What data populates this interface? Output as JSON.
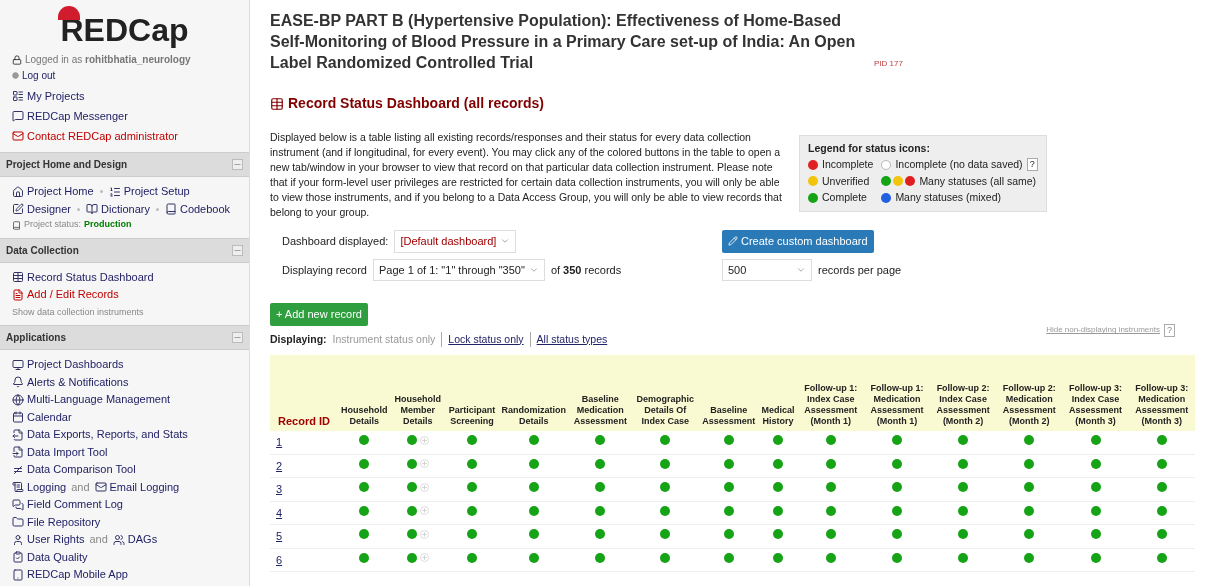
{
  "sidebar": {
    "logo": "REDCap",
    "user": "Logged in as **rohitbhatia_neurology**",
    "logout": "Log out",
    "links": [
      {
        "label": "My Projects",
        "kind": "link"
      },
      {
        "label": "REDCap Messenger",
        "kind": "link"
      },
      {
        "label": "Contact REDCap administrator",
        "kind": "alert"
      }
    ],
    "sections": [
      {
        "title": "Project Home and Design",
        "lines": [
          [
            {
              "label": "Project Home",
              "kind": "link"
            },
            {
              "label": "Project Setup",
              "kind": "link"
            }
          ],
          [
            {
              "label": "Designer",
              "kind": "link"
            },
            {
              "label": "Dictionary",
              "kind": "link"
            },
            {
              "label": "Codebook",
              "kind": "link"
            }
          ]
        ],
        "status_label": "Project status:",
        "status_value": "Production"
      },
      {
        "title": "Data Collection",
        "lines": [
          [
            {
              "label": "Record Status Dashboard",
              "kind": "link"
            }
          ],
          [
            {
              "label": "Add / Edit Records",
              "kind": "alert"
            }
          ]
        ],
        "note": "Show data collection instruments"
      },
      {
        "title": "Applications",
        "lines": [
          [
            {
              "label": "Project Dashboards",
              "kind": "link"
            }
          ],
          [
            {
              "label": "Alerts & Notifications",
              "kind": "link"
            }
          ],
          [
            {
              "label": "Multi-Language Management",
              "kind": "link"
            }
          ],
          [
            {
              "label": "Calendar",
              "kind": "link"
            }
          ],
          [
            {
              "label": "Data Exports, Reports, and Stats",
              "kind": "link"
            }
          ],
          [
            {
              "label": "Data Import Tool",
              "kind": "link"
            }
          ],
          [
            {
              "label": "Data Comparison Tool",
              "kind": "link"
            }
          ],
          [
            {
              "label": "Logging",
              "kind": "link"
            },
            {
              "label": "and",
              "kind": "joiner"
            },
            {
              "label": "Email Logging",
              "kind": "link"
            }
          ],
          [
            {
              "label": "Field Comment Log",
              "kind": "link"
            }
          ],
          [
            {
              "label": "File Repository",
              "kind": "link"
            }
          ],
          [
            {
              "label": "User Rights",
              "kind": "link"
            },
            {
              "label": "and",
              "kind": "joiner"
            },
            {
              "label": "DAGs",
              "kind": "link"
            }
          ],
          [
            {
              "label": "Data Quality",
              "kind": "link"
            }
          ],
          [
            {
              "label": "REDCap Mobile App",
              "kind": "link"
            }
          ]
        ]
      }
    ]
  },
  "project": {
    "title": "EASE-BP PART B (Hypertensive Population): Effectiveness of Home-Based Self-Monitoring of Blood Pressure in a Primary Care set-up of India: An Open Label Randomized Controlled Trial",
    "pid": "PID 177"
  },
  "heading": "Record Status Dashboard (all records)",
  "description": "Displayed below is a table listing all existing records/responses and their status for every data collection instrument (and if longitudinal, for every event). You may click any of the colored buttons in the table to open a new tab/window in your browser to view that record on that particular data collection instrument. Please note that if your form-level user privileges are restricted for certain data collection instruments, you will only be able to view those instruments, and if you belong to a Data Access Group, you will only be able to view records that belong to your group.",
  "legend": {
    "title": "Legend for status icons:",
    "items": [
      {
        "icons": [
          {
            "color": "#e02020"
          }
        ],
        "label": "Incomplete"
      },
      {
        "icons": [
          {
            "color": "#ffffff"
          }
        ],
        "label": "Incomplete (no data saved)",
        "help": "?"
      },
      {
        "icons": [
          {
            "color": "#f2c40c"
          }
        ],
        "label": "Unverified"
      },
      {
        "icons": [
          {
            "color": "#16a316"
          },
          {
            "color": "#f2c40c"
          },
          {
            "color": "#e02020"
          }
        ],
        "label": "Many statuses (all same)"
      },
      {
        "icons": [
          {
            "color": "#16a316"
          }
        ],
        "label": "Complete"
      },
      {
        "icons": [
          {
            "color": "#2160e0"
          }
        ],
        "label": "Many statuses (mixed)"
      }
    ]
  },
  "dashboard": {
    "label": "Dashboard displayed:",
    "value": "[Default dashboard]",
    "create_button": "Create custom dashboard",
    "record_label": "Displaying record",
    "page_value": "Page 1 of 1: \"1\" through \"350\"",
    "count": "of **350** records",
    "per_page_value": "500",
    "per_page_label": "records per page"
  },
  "add_button": "+ Add new record",
  "displaying": {
    "label": "Displaying:",
    "options": [
      {
        "label": "Instrument status only",
        "selected": true
      },
      {
        "label": "Lock status only",
        "selected": false
      },
      {
        "label": "All status types",
        "selected": false
      }
    ],
    "hide_link": "Hide non-displaying instruments",
    "help": "?"
  },
  "table": {
    "columns": [
      {
        "label": "Record ID",
        "kind": "id"
      },
      {
        "label": "Household Details",
        "kind": "form"
      },
      {
        "label": "Household Member Details",
        "kind": "repeating"
      },
      {
        "label": "Participant Screening",
        "kind": "form"
      },
      {
        "label": "Randomization Details",
        "kind": "form"
      },
      {
        "label": "Baseline Medication Assessment",
        "kind": "form"
      },
      {
        "label": "Demographic Details Of Index Case",
        "kind": "form"
      },
      {
        "label": "Baseline Assessment",
        "kind": "form"
      },
      {
        "label": "Medical History",
        "kind": "form"
      },
      {
        "label": "Follow-up 1: Index Case Assessment (Month 1)",
        "kind": "form"
      },
      {
        "label": "Follow-up 1: Medication Assessment (Month 1)",
        "kind": "form"
      },
      {
        "label": "Follow-up 2: Index Case Assessment (Month 2)",
        "kind": "form"
      },
      {
        "label": "Follow-up 2: Medication Assessment (Month 2)",
        "kind": "form"
      },
      {
        "label": "Follow-up 3: Index Case Assessment (Month 3)",
        "kind": "form"
      },
      {
        "label": "Follow-up 3: Medication Assessment (Month 3)",
        "kind": "form"
      }
    ],
    "rows": [
      {
        "id": "1",
        "cells": [
          {
            "color": "#16a316"
          },
          {
            "color": "#16a316"
          },
          {
            "color": "#16a316"
          },
          {
            "color": "#16a316"
          },
          {
            "color": "#16a316"
          },
          {
            "color": "#16a316"
          },
          {
            "color": "#16a316"
          },
          {
            "color": "#16a316"
          },
          {
            "color": "#16a316"
          },
          {
            "color": "#16a316"
          },
          {
            "color": "#16a316"
          },
          {
            "color": "#16a316"
          },
          {
            "color": "#16a316"
          },
          {
            "color": "#16a316"
          }
        ]
      },
      {
        "id": "2",
        "cells": [
          {
            "color": "#16a316"
          },
          {
            "color": "#16a316"
          },
          {
            "color": "#16a316"
          },
          {
            "color": "#16a316"
          },
          {
            "color": "#16a316"
          },
          {
            "color": "#16a316"
          },
          {
            "color": "#16a316"
          },
          {
            "color": "#16a316"
          },
          {
            "color": "#16a316"
          },
          {
            "color": "#16a316"
          },
          {
            "color": "#16a316"
          },
          {
            "color": "#16a316"
          },
          {
            "color": "#16a316"
          },
          {
            "color": "#16a316"
          }
        ]
      },
      {
        "id": "3",
        "cells": [
          {
            "color": "#16a316"
          },
          {
            "color": "#16a316"
          },
          {
            "color": "#16a316"
          },
          {
            "color": "#16a316"
          },
          {
            "color": "#16a316"
          },
          {
            "color": "#16a316"
          },
          {
            "color": "#16a316"
          },
          {
            "color": "#16a316"
          },
          {
            "color": "#16a316"
          },
          {
            "color": "#16a316"
          },
          {
            "color": "#16a316"
          },
          {
            "color": "#16a316"
          },
          {
            "color": "#16a316"
          },
          {
            "color": "#16a316"
          }
        ]
      },
      {
        "id": "4",
        "cells": [
          {
            "color": "#16a316"
          },
          {
            "color": "#16a316"
          },
          {
            "color": "#16a316"
          },
          {
            "color": "#16a316"
          },
          {
            "color": "#16a316"
          },
          {
            "color": "#16a316"
          },
          {
            "color": "#16a316"
          },
          {
            "color": "#16a316"
          },
          {
            "color": "#16a316"
          },
          {
            "color": "#16a316"
          },
          {
            "color": "#16a316"
          },
          {
            "color": "#16a316"
          },
          {
            "color": "#16a316"
          },
          {
            "color": "#16a316"
          }
        ]
      },
      {
        "id": "5",
        "cells": [
          {
            "color": "#16a316"
          },
          {
            "color": "#16a316"
          },
          {
            "color": "#16a316"
          },
          {
            "color": "#16a316"
          },
          {
            "color": "#16a316"
          },
          {
            "color": "#16a316"
          },
          {
            "color": "#16a316"
          },
          {
            "color": "#16a316"
          },
          {
            "color": "#16a316"
          },
          {
            "color": "#16a316"
          },
          {
            "color": "#16a316"
          },
          {
            "color": "#16a316"
          },
          {
            "color": "#16a316"
          },
          {
            "color": "#16a316"
          }
        ]
      },
      {
        "id": "6",
        "cells": [
          {
            "color": "#16a316"
          },
          {
            "color": "#16a316"
          },
          {
            "color": "#16a316"
          },
          {
            "color": "#16a316"
          },
          {
            "color": "#16a316"
          },
          {
            "color": "#16a316"
          },
          {
            "color": "#16a316"
          },
          {
            "color": "#16a316"
          },
          {
            "color": "#16a316"
          },
          {
            "color": "#16a316"
          },
          {
            "color": "#16a316"
          },
          {
            "color": "#16a316"
          },
          {
            "color": "#16a316"
          },
          {
            "color": "#16a316"
          }
        ]
      }
    ]
  }
}
